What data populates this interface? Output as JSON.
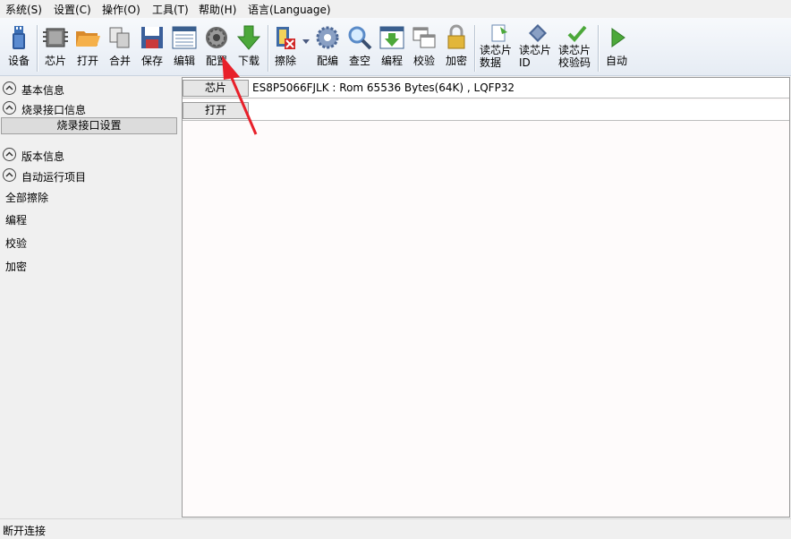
{
  "menu": [
    "系统(S)",
    "设置(C)",
    "操作(O)",
    "工具(T)",
    "帮助(H)",
    "语言(Language)"
  ],
  "toolbar": {
    "device": "设备",
    "chip": "芯片",
    "open": "打开",
    "merge": "合并",
    "save": "保存",
    "edit": "编辑",
    "config": "配置",
    "download": "下载",
    "erase": "擦除",
    "config_edit": "配编",
    "blank_check": "查空",
    "program": "编程",
    "verify": "校验",
    "encrypt": "加密",
    "read_data": [
      "读芯片",
      "数据"
    ],
    "read_id": [
      "读芯片",
      "ID"
    ],
    "read_checksum": [
      "读芯片",
      "校验码"
    ],
    "auto": "自动"
  },
  "sidebar": {
    "basic_info": "基本信息",
    "burn_iface_info": "烧录接口信息",
    "burn_iface_setting": "烧录接口设置",
    "version_info": "版本信息",
    "auto_items": "自动运行项目",
    "items": [
      "全部擦除",
      "编程",
      "校验",
      "加密"
    ]
  },
  "main": {
    "chip_label": "芯片",
    "chip_value": "ES8P5066FJLK : Rom 65536 Bytes(64K) , LQFP32",
    "open_label": "打开",
    "open_value": ""
  },
  "status": "断开连接",
  "colors": {
    "accent_arrow": "#e8202a",
    "highlight_box": "#dcdcdc"
  }
}
